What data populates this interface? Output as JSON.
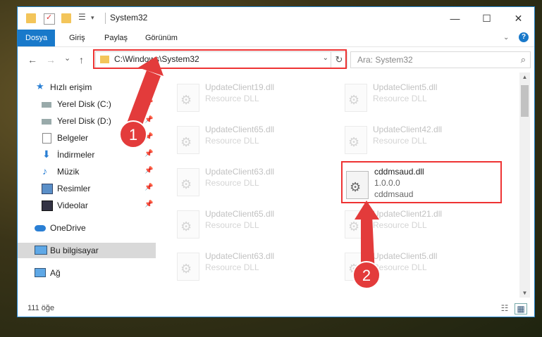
{
  "window": {
    "title": "System32",
    "minimize": "—",
    "maximize": "☐",
    "close": "✕"
  },
  "ribbon": {
    "tabs": [
      "Dosya",
      "Giriş",
      "Paylaş",
      "Görünüm"
    ],
    "help": "?"
  },
  "nav": {
    "back": "←",
    "forward": "→",
    "recent": "⌄",
    "up": "↑"
  },
  "address": {
    "path": "C:\\Windows\\System32",
    "dropdown": "⌄",
    "refresh": "↻"
  },
  "search": {
    "placeholder": "Ara: System32"
  },
  "sidebar": {
    "items": [
      {
        "label": "Hızlı erişim",
        "icon": "star-icon"
      },
      {
        "label": "Yerel Disk (C:)",
        "icon": "drive-icon"
      },
      {
        "label": "Yerel Disk (D:)",
        "icon": "drive-icon"
      },
      {
        "label": "Belgeler",
        "icon": "documents-icon"
      },
      {
        "label": "İndirmeler",
        "icon": "download-icon"
      },
      {
        "label": "Müzik",
        "icon": "music-icon"
      },
      {
        "label": "Resimler",
        "icon": "pictures-icon"
      },
      {
        "label": "Videolar",
        "icon": "videos-icon"
      },
      {
        "label": "OneDrive",
        "icon": "cloud-icon"
      },
      {
        "label": "Bu bilgisayar",
        "icon": "computer-icon"
      },
      {
        "label": "Ağ",
        "icon": "network-icon"
      }
    ]
  },
  "files": [
    {
      "name": "UpdateClient19.dll",
      "desc": "Resource DLL"
    },
    {
      "name": "UpdateClient5.dll",
      "desc": "Resource DLL"
    },
    {
      "name": "UpdateClient65.dll",
      "desc": "Resource DLL"
    },
    {
      "name": "UpdateClient42.dll",
      "desc": "Resource DLL"
    },
    {
      "name": "UpdateClient63.dll",
      "desc": "Resource DLL"
    },
    {
      "name": "cddmsaud.dll",
      "version": "1.0.0.0",
      "desc": "cddmsaud"
    },
    {
      "name": "UpdateClient65.dll",
      "desc": "Resource DLL"
    },
    {
      "name": "UpdateClient21.dll",
      "desc": "Resource DLL"
    },
    {
      "name": "UpdateClient63.dll",
      "desc": "Resource DLL"
    },
    {
      "name": "UpdateClient5.dll",
      "desc": "Resource DLL"
    }
  ],
  "status": {
    "count": "111 öğe"
  },
  "annotations": {
    "step1": "1",
    "step2": "2",
    "color": "#e33b3b"
  }
}
